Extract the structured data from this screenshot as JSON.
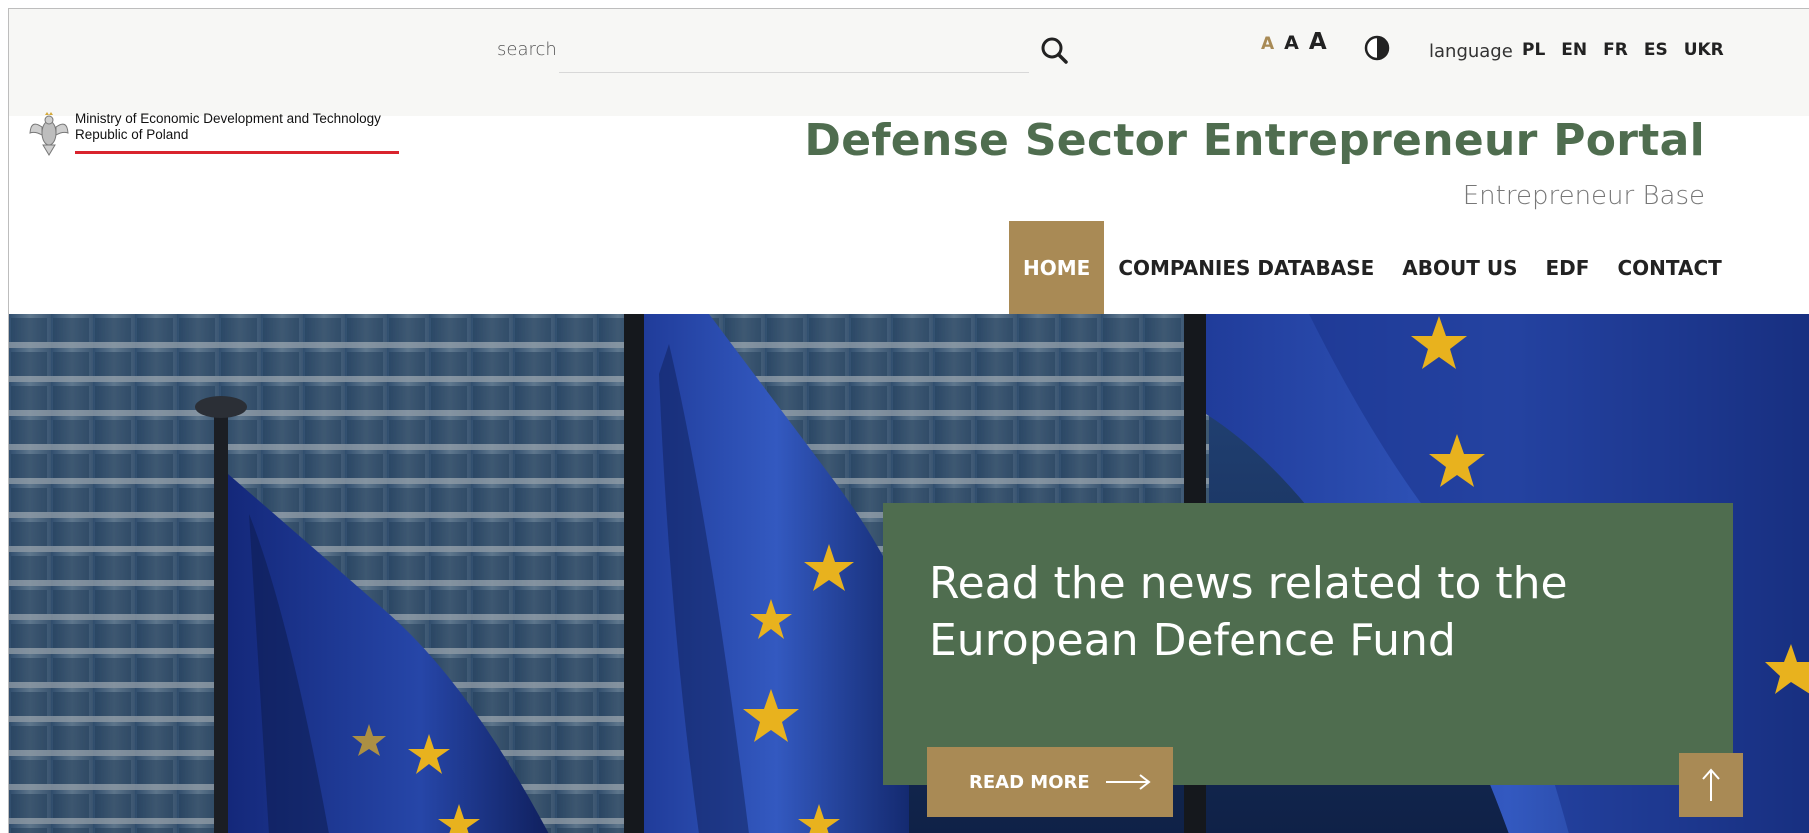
{
  "search": {
    "label": "search",
    "value": "",
    "placeholder": ""
  },
  "accessibility": {
    "font_small": "A",
    "font_medium": "A",
    "font_large": "A",
    "contrast_icon": "contrast-icon"
  },
  "language": {
    "label": "language",
    "options": [
      "PL",
      "EN",
      "FR",
      "ES",
      "UKR"
    ]
  },
  "logo": {
    "line1": "Ministry of Economic Development and Technology",
    "line2": "Republic of Poland",
    "icon": "eagle-emblem-icon"
  },
  "header": {
    "title": "Defense Sector Entrepreneur Portal",
    "subtitle": "Entrepreneur Base"
  },
  "nav": {
    "items": [
      {
        "label": "HOME",
        "active": true
      },
      {
        "label": "COMPANIES DATABASE",
        "active": false
      },
      {
        "label": "ABOUT US",
        "active": false
      },
      {
        "label": "EDF",
        "active": false
      },
      {
        "label": "CONTACT",
        "active": false
      }
    ]
  },
  "hero": {
    "news_title": "Read the news related to the European Defence Fund",
    "read_more_label": "READ MORE",
    "read_more_icon": "arrow-right-icon",
    "to_top_icon": "arrow-up-icon"
  },
  "colors": {
    "accent_gold": "#a98a55",
    "brand_green": "#4f6d4f",
    "flag_blue": "#1f3a8a",
    "star_gold": "#e8b21e",
    "logo_red": "#d9232d"
  }
}
